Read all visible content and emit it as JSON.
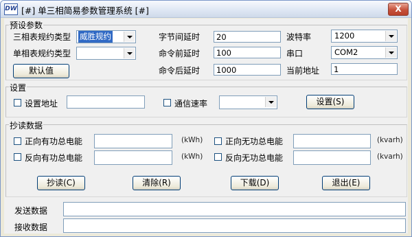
{
  "window": {
    "icon_text": "DW",
    "title": "[#] 单三相简易参数管理系统 [#]",
    "close_label": "X"
  },
  "preset": {
    "title": "预设参数",
    "three_phase_type_label": "三相表规约类型",
    "three_phase_type_value": "威胜规约",
    "single_phase_type_label": "单相表规约类型",
    "single_phase_type_value": "",
    "default_button": "默认值",
    "byte_delay_label": "字节间延时",
    "byte_delay_value": "20",
    "pre_cmd_delay_label": "命令前延时",
    "pre_cmd_delay_value": "100",
    "post_cmd_delay_label": "命令后延时",
    "post_cmd_delay_value": "1000",
    "baud_label": "波特率",
    "baud_value": "1200",
    "port_label": "串口",
    "port_value": "COM2",
    "address_label": "当前地址",
    "address_value": "1"
  },
  "settings": {
    "title": "设置",
    "set_address_label": "设置地址",
    "set_address_value": "",
    "comm_rate_label": "通信速率",
    "comm_rate_value": "",
    "set_button": "设置(S)"
  },
  "reading": {
    "title": "抄读数据",
    "forward_active_label": "正向有功总电能",
    "forward_active_value": "",
    "forward_active_unit": "(kWh)",
    "reverse_active_label": "反向有功总电能",
    "reverse_active_value": "",
    "reverse_active_unit": "(kWh)",
    "forward_reactive_label": "正向无功总电能",
    "forward_reactive_value": "",
    "forward_reactive_unit": "(kvarh)",
    "reverse_reactive_label": "反向无功总电能",
    "reverse_reactive_value": "",
    "reverse_reactive_unit": "(kvarh)",
    "read_button": "抄读(C)",
    "clear_button": "清除(R)",
    "download_button": "下载(D)",
    "exit_button": "退出(E)"
  },
  "io": {
    "send_label": "发送数据",
    "send_value": "",
    "receive_label": "接收数据",
    "receive_value": ""
  }
}
